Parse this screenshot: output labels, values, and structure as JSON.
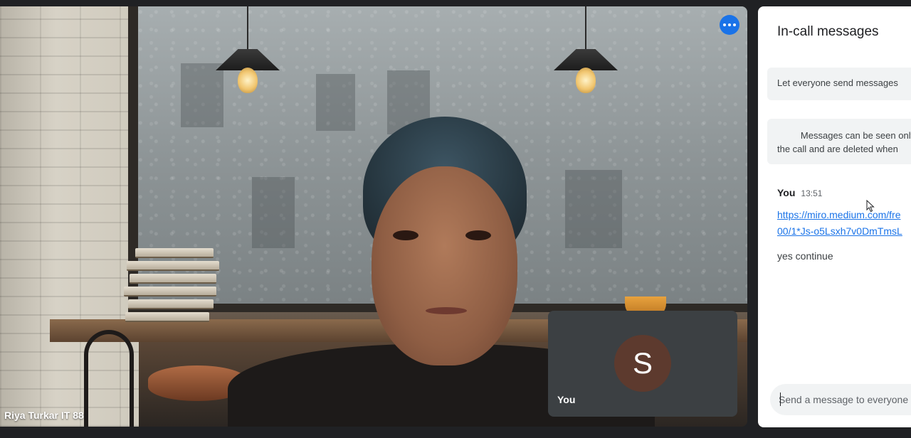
{
  "main_video": {
    "participant_name": "Riya Turkar IT 88",
    "more_options_icon": "more-horizontal-icon"
  },
  "self_view": {
    "avatar_initial": "S",
    "label": "You"
  },
  "chat_panel": {
    "title": "In-call messages",
    "toggle_label": "Let everyone send messages",
    "info_line1": "Messages can be seen only",
    "info_line2": "the call and are deleted when",
    "messages": [
      {
        "sender": "You",
        "time": "13:51",
        "link_line1": "https://miro.medium.com/fre",
        "link_line2": "00/1*Js-o5Lsxh7v0DmTmsL",
        "text": "yes continue"
      }
    ],
    "input_placeholder": "Send a message to everyone"
  },
  "colors": {
    "accent": "#1a73e8",
    "panel_bg": "#ffffff",
    "app_bg": "#202124",
    "self_tile_bg": "#3c4043",
    "avatar_bg": "#5d3a2e"
  }
}
